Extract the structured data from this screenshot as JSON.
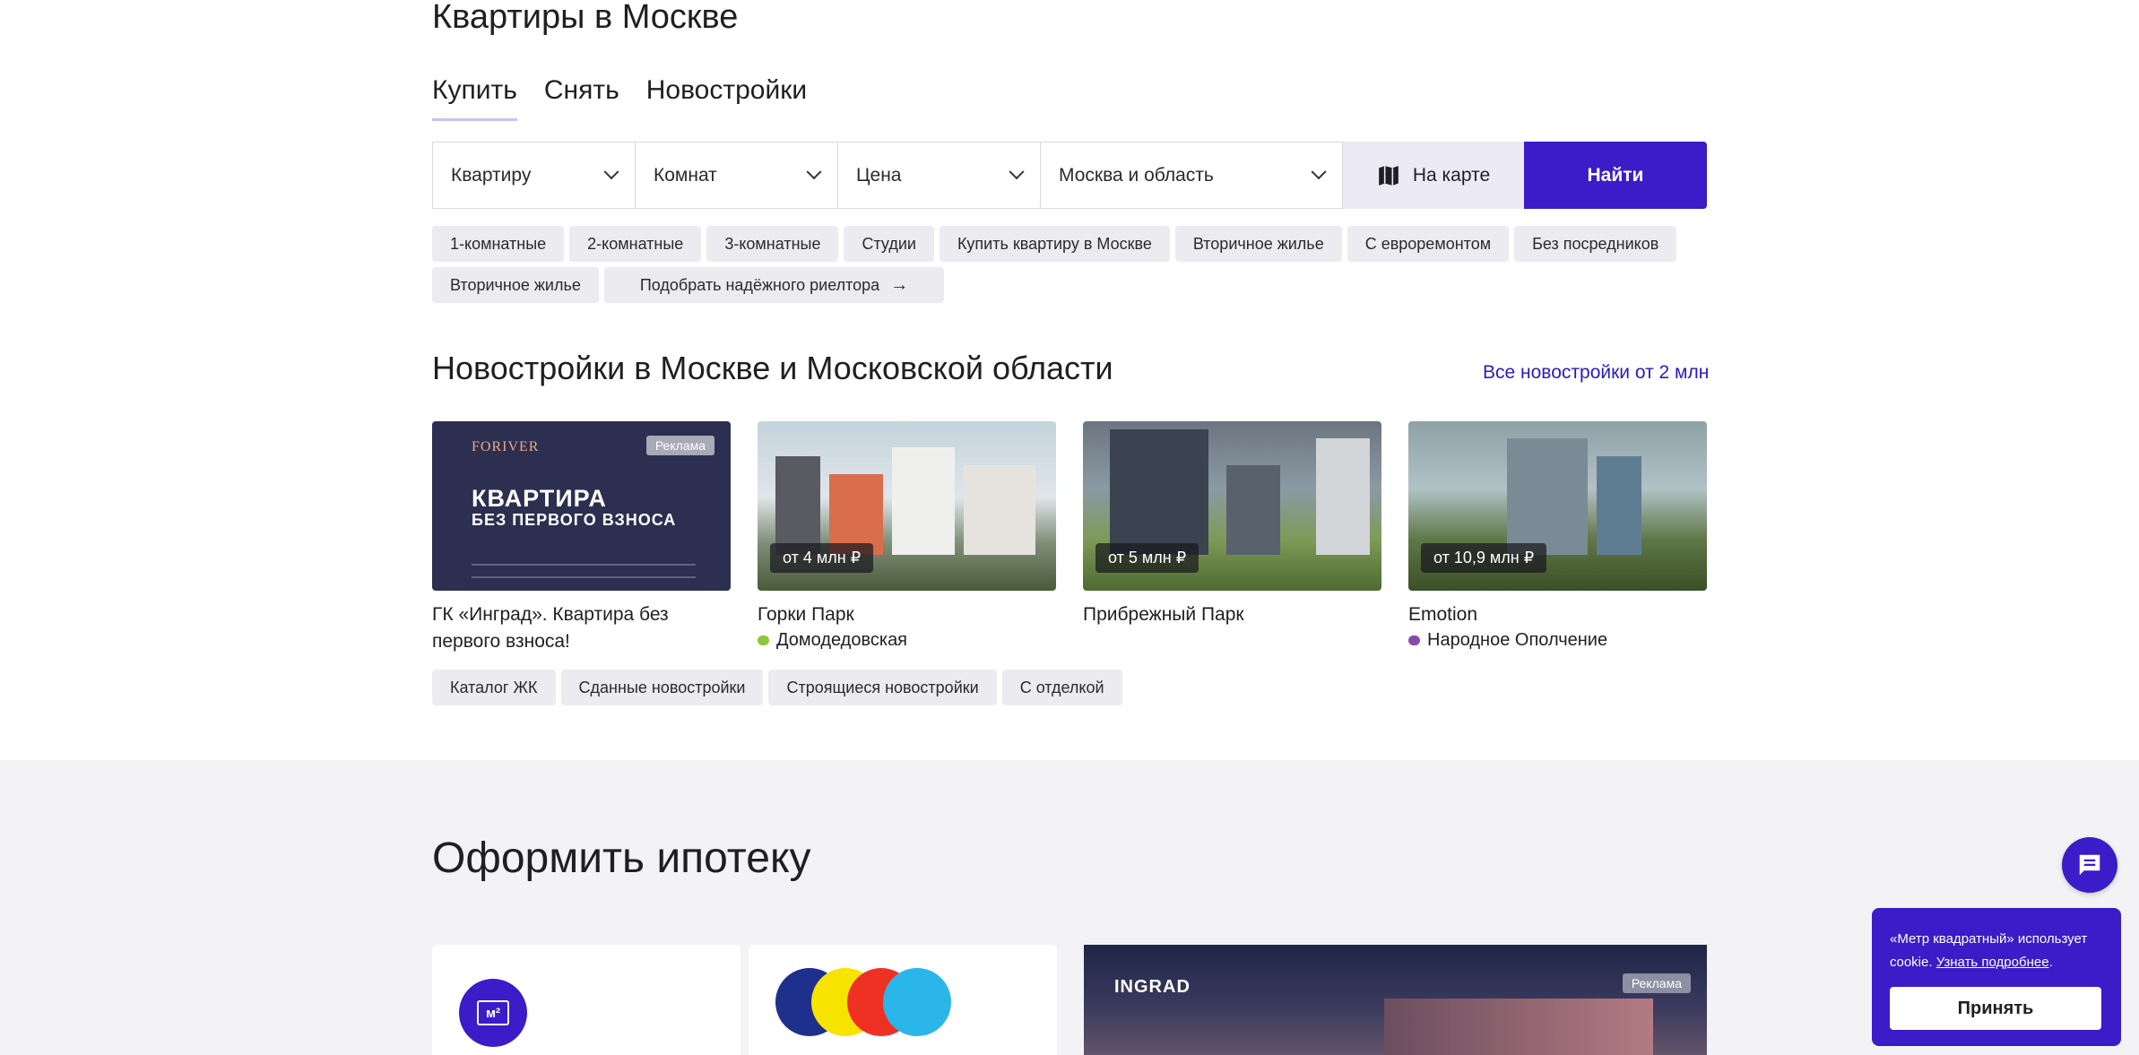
{
  "page_title": "Квартиры в Москве",
  "tabs": [
    {
      "label": "Купить",
      "active": true
    },
    {
      "label": "Снять",
      "active": false
    },
    {
      "label": "Новостройки",
      "active": false
    }
  ],
  "search": {
    "type": "Квартиру",
    "rooms": "Комнат",
    "price": "Цена",
    "region": "Москва и область",
    "map_label": "На карте",
    "find_label": "Найти"
  },
  "quick_filters": [
    "1-комнатные",
    "2-комнатные",
    "3-комнатные",
    "Студии",
    "Купить квартиру в Москве",
    "Вторичное жилье",
    "С евроремонтом",
    "Без посредников",
    "Вторичное жилье",
    "Подобрать надёжного риелтора"
  ],
  "new_buildings": {
    "title": "Новостройки в Москве и Московской области",
    "all_link": "Все новостройки от 2 млн",
    "cards": [
      {
        "name": "ГК «Инград». Квартира без первого взноса!",
        "ad_badge": "Реклама",
        "ad_logo": "FORIVER",
        "ad_headline": "КВАРТИРА",
        "ad_subline": "БЕЗ ПЕРВОГО ВЗНОСА"
      },
      {
        "name": "Горки Парк",
        "price": "от 4 млн ₽",
        "metro": "Домодедовская",
        "metro_color": "#8cc63f"
      },
      {
        "name": "Прибрежный Парк",
        "price": "от 5 млн ₽"
      },
      {
        "name": "Emotion",
        "price": "от 10,9 млн ₽",
        "metro": "Народное Ополчение",
        "metro_color": "#8a4ba8"
      }
    ],
    "chips": [
      "Каталог ЖК",
      "Сданные новостройки",
      "Строящиеся новостройки",
      "С отделкой"
    ]
  },
  "mortgage": {
    "title": "Оформить ипотеку",
    "m2_logo": "м²",
    "ad_logo": "INGRAD",
    "ad_badge": "Реклама"
  },
  "cookie": {
    "text": "«Метр квадратный» использует cookie.",
    "link": "Узнать подробнее",
    "accept": "Принять"
  },
  "colors": {
    "accent": "#3a1cc8",
    "link": "#2a1bbf"
  }
}
